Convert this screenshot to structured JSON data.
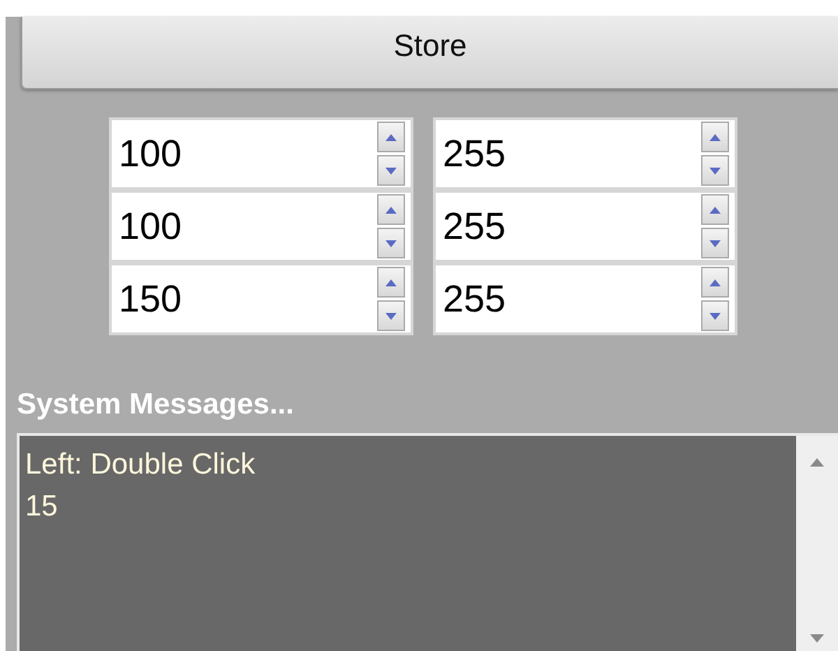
{
  "store_button": {
    "label": "Store"
  },
  "spinner_rows": [
    {
      "values": [
        "100",
        "255"
      ]
    },
    {
      "values": [
        "100",
        "255"
      ]
    },
    {
      "values": [
        "150",
        "255"
      ]
    }
  ],
  "messages": {
    "heading": "System Messages...",
    "lines": [
      "Left: Double Click",
      "15"
    ]
  }
}
